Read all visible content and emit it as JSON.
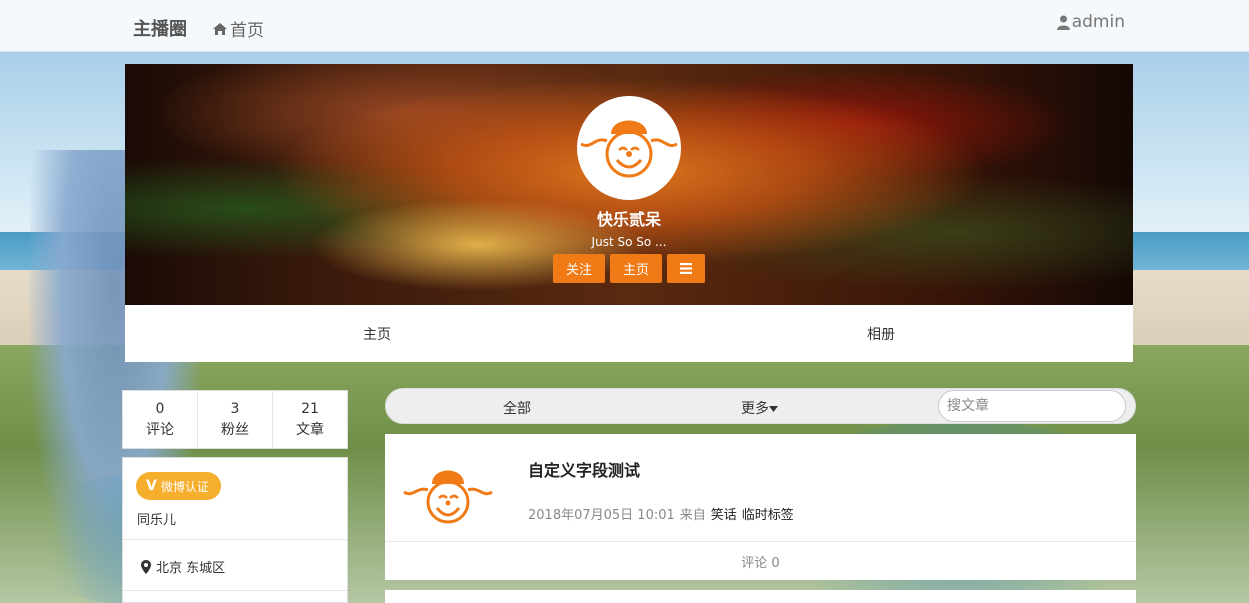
{
  "navbar": {
    "brand": "主播圈",
    "home_label": "首页",
    "user_label": "admin"
  },
  "profile": {
    "nickname": "快乐贰呆",
    "signature": "Just So So ...",
    "buttons": {
      "follow": "关注",
      "homepage": "主页"
    },
    "accent": "#f07a16"
  },
  "tabs": [
    {
      "label": "主页"
    },
    {
      "label": "相册"
    }
  ],
  "stats": [
    {
      "value": "0",
      "label": "评论"
    },
    {
      "value": "3",
      "label": "粉丝"
    },
    {
      "value": "21",
      "label": "文章"
    }
  ],
  "info": {
    "badge": "微博认证",
    "badge_color": "#f6ae2d",
    "real_name": "同乐儿",
    "location": "北京 东城区"
  },
  "filter": {
    "all_label": "全部",
    "more_label": "更多",
    "search_placeholder": "搜文章"
  },
  "posts": [
    {
      "title": "自定义字段测试",
      "datetime": "2018年07月05日 10:01",
      "from_label": "来自",
      "categories": [
        "笑话",
        "临时标签"
      ],
      "comments": "评论 0"
    }
  ],
  "icons": {
    "home": "home-icon",
    "user": "user-icon",
    "menu": "menu-icon",
    "caret": "caret-down-icon",
    "location": "map-marker-icon"
  }
}
